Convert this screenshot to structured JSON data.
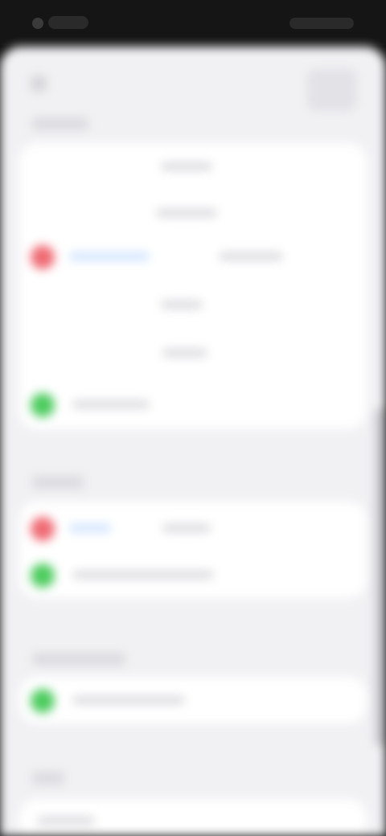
{
  "colors": {
    "accent": "#3b82f6",
    "red": "#ef6b73",
    "green": "#4dcc5e",
    "background": "#f1f1f4",
    "card": "#ffffff"
  },
  "nav": {
    "back_icon": "chevron-left-icon",
    "action_icon": "toolbar-action-icon"
  },
  "sections": [
    {
      "title": "",
      "rows": [
        {
          "label": "",
          "status_color": "red",
          "value": ""
        },
        {
          "label": "",
          "status_color": "green",
          "value": ""
        }
      ]
    },
    {
      "title": "",
      "rows": [
        {
          "label": "",
          "status_color": "red",
          "value": ""
        },
        {
          "label": "",
          "status_color": "green",
          "value": ""
        }
      ]
    },
    {
      "title": "",
      "rows": [
        {
          "label": "",
          "status_color": "green",
          "value": ""
        }
      ]
    },
    {
      "title": "",
      "rows": [
        {
          "label": "",
          "status_color": "",
          "value": ""
        }
      ]
    }
  ]
}
